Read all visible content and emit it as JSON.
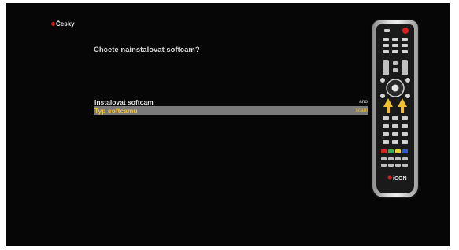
{
  "language": {
    "label": "Česky",
    "icon": "flag-icon"
  },
  "dialog": {
    "question": "Chcete nainstalovat softcam?",
    "options": [
      {
        "label": "Instalovat softcam",
        "value": "ano",
        "selected": false
      },
      {
        "label": "Typ softcamu",
        "value": "scam",
        "selected": true
      }
    ]
  },
  "remote": {
    "icon": "remote-control-icon",
    "highlighted_keys": [
      "up-arrow-icon",
      "down-arrow-icon"
    ],
    "brand_logo": "iCON"
  },
  "colors": {
    "background": "#060606",
    "selected_row": "#7a7a7a",
    "selected_text": "#f0c23a",
    "accent_red": "#d61818"
  }
}
